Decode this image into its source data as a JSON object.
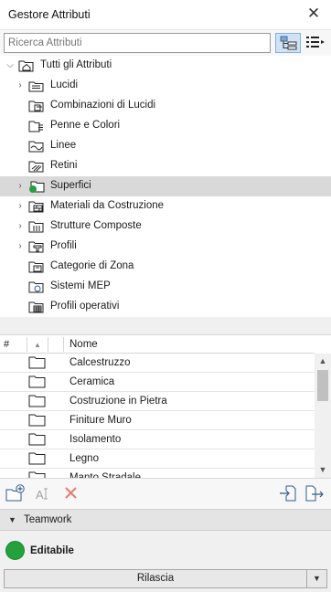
{
  "window": {
    "title": "Gestore Attributi",
    "close_icon": "close-icon"
  },
  "search": {
    "placeholder": "Ricerca Attributi",
    "value": ""
  },
  "toolbar": {
    "view_mode_icon": "tree-view-icon",
    "list_options_icon": "list-options-icon"
  },
  "tree": {
    "root": "Tutti gli Attributi",
    "items": [
      {
        "label": "Lucidi",
        "icon": "layers-icon",
        "expandable": true,
        "selected": false
      },
      {
        "label": "Combinazioni di Lucidi",
        "icon": "layer-combinations-icon",
        "expandable": false,
        "selected": false
      },
      {
        "label": "Penne e Colori",
        "icon": "pen-color-icon",
        "expandable": false,
        "selected": false
      },
      {
        "label": "Linee",
        "icon": "line-type-icon",
        "expandable": false,
        "selected": false
      },
      {
        "label": "Retini",
        "icon": "fill-icon",
        "expandable": false,
        "selected": false
      },
      {
        "label": "Superfici",
        "icon": "surface-icon",
        "expandable": true,
        "selected": true
      },
      {
        "label": "Materiali da Costruzione",
        "icon": "building-material-icon",
        "expandable": true,
        "selected": false
      },
      {
        "label": "Strutture Composte",
        "icon": "composite-icon",
        "expandable": true,
        "selected": false
      },
      {
        "label": "Profili",
        "icon": "profile-icon",
        "expandable": true,
        "selected": false
      },
      {
        "label": "Categorie di Zona",
        "icon": "zone-category-icon",
        "expandable": false,
        "selected": false
      },
      {
        "label": "Sistemi MEP",
        "icon": "mep-system-icon",
        "expandable": false,
        "selected": false
      },
      {
        "label": "Profili operativi",
        "icon": "operation-profile-icon",
        "expandable": false,
        "selected": false
      }
    ]
  },
  "table": {
    "columns": {
      "number": "#",
      "name": "Nome"
    },
    "rows": [
      "Calcestruzzo",
      "Ceramica",
      "Costruzione in Pietra",
      "Finiture Muro",
      "Isolamento",
      "Legno",
      "Manto Stradale"
    ]
  },
  "actions": {
    "new_folder_icon": "new-folder-icon",
    "rename_icon": "rename-icon",
    "delete_icon": "delete-icon",
    "import_icon": "import-icon",
    "export_icon": "export-icon"
  },
  "teamwork": {
    "section_title": "Teamwork",
    "status": "Editabile",
    "status_color": "#22a23a",
    "release_button": "Rilascia"
  }
}
